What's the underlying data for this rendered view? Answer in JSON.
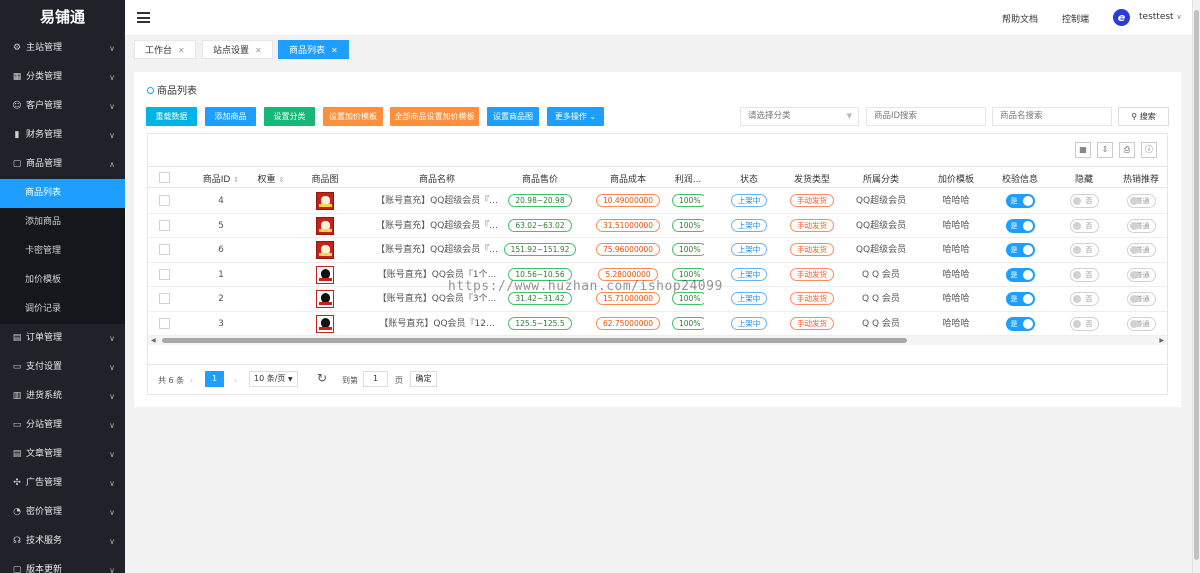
{
  "sidebar": {
    "logo": "易铺通",
    "menu_top": [
      {
        "label": "主站管理",
        "icon": "⚙",
        "icon_name": "gear-icon"
      },
      {
        "label": "分类管理",
        "icon": "▦",
        "icon_name": "grid-icon"
      },
      {
        "label": "客户管理",
        "icon": "☺",
        "icon_name": "user-icon"
      },
      {
        "label": "财务管理",
        "icon": "▮",
        "icon_name": "bar-chart-icon"
      },
      {
        "label": "商品管理",
        "icon": "▢",
        "icon_name": "box-icon"
      }
    ],
    "submenu": [
      {
        "label": "商品列表",
        "active": true
      },
      {
        "label": "添加商品",
        "active": false
      },
      {
        "label": "卡密管理",
        "active": false
      },
      {
        "label": "加价模板",
        "active": false
      },
      {
        "label": "调价记录",
        "active": false
      }
    ],
    "menu_bottom": [
      {
        "label": "订单管理",
        "icon": "▤",
        "icon_name": "order-icon"
      },
      {
        "label": "支付设置",
        "icon": "▭",
        "icon_name": "wallet-icon"
      },
      {
        "label": "进货系统",
        "icon": "▥",
        "icon_name": "stock-icon"
      },
      {
        "label": "分站管理",
        "icon": "▭",
        "icon_name": "monitor-icon"
      },
      {
        "label": "文章管理",
        "icon": "▤",
        "icon_name": "article-icon"
      },
      {
        "label": "广告管理",
        "icon": "✣",
        "icon_name": "ad-icon"
      },
      {
        "label": "密价管理",
        "icon": "◔",
        "icon_name": "price-icon"
      },
      {
        "label": "技术服务",
        "icon": "☊",
        "icon_name": "headset-icon"
      },
      {
        "label": "版本更新",
        "icon": "▢",
        "icon_name": "update-icon"
      }
    ]
  },
  "header": {
    "help": "帮助文档",
    "console": "控制端",
    "avatar_letter": "e",
    "username": "testtest"
  },
  "tabs": [
    {
      "label": "工作台",
      "active": false
    },
    {
      "label": "站点设置",
      "active": false
    },
    {
      "label": "商品列表",
      "active": true
    }
  ],
  "page": {
    "title": "商品列表",
    "buttons": [
      {
        "label": "重载数据",
        "color": "#00b5e5"
      },
      {
        "label": "添加商品",
        "color": "#1e9fff"
      },
      {
        "label": "设置分类",
        "color": "#16b777"
      },
      {
        "label": "设置加价模板",
        "color": "#ff8f3b"
      },
      {
        "label": "全部商品设置加价模板",
        "color": "#ff8f3b"
      },
      {
        "label": "设置商品图",
        "color": "#1e9fff"
      },
      {
        "label": "更多操作",
        "color": "#1e9fff"
      }
    ],
    "category_select": "请选择分类",
    "id_search_placeholder": "商品ID搜索",
    "name_search_placeholder": "商品名搜索",
    "search_label": "搜索"
  },
  "table": {
    "columns": [
      "商品ID",
      "权重",
      "商品图",
      "商品名称",
      "商品售价",
      "商品成本",
      "利润...",
      "状态",
      "发货类型",
      "所属分类",
      "加价模板",
      "校验信息",
      "隐藏",
      "热销推荐"
    ],
    "rows": [
      {
        "id": "4",
        "img": "vip",
        "name": "【账号直充】QQ超级会员『...",
        "price": "20.98~20.98",
        "cost": "10.49000000",
        "profit": "100%",
        "status": "上架中",
        "ship": "手动发货",
        "category": "QQ超级会员",
        "template": "哈哈哈",
        "verify": "是",
        "hidden": "否",
        "hot": "普通"
      },
      {
        "id": "5",
        "img": "vip",
        "name": "【账号直充】QQ超级会员『...",
        "price": "63.02~63.02",
        "cost": "31.51000000",
        "profit": "100%",
        "status": "上架中",
        "ship": "手动发货",
        "category": "QQ超级会员",
        "template": "哈哈哈",
        "verify": "是",
        "hidden": "否",
        "hot": "普通"
      },
      {
        "id": "6",
        "img": "vip",
        "name": "【账号直充】QQ超级会员『...",
        "price": "151.92~151.92",
        "cost": "75.96000000",
        "profit": "100%",
        "status": "上架中",
        "ship": "手动发货",
        "category": "QQ超级会员",
        "template": "哈哈哈",
        "verify": "是",
        "hidden": "否",
        "hot": "普通"
      },
      {
        "id": "1",
        "img": "qq",
        "name": "【账号直充】QQ会员『1个...",
        "price": "10.56~10.56",
        "cost": "5.28000000",
        "profit": "100%",
        "status": "上架中",
        "ship": "手动发货",
        "category": "Q Q 会员",
        "template": "哈哈哈",
        "verify": "是",
        "hidden": "否",
        "hot": "普通"
      },
      {
        "id": "2",
        "img": "qq",
        "name": "【账号直充】QQ会员『3个...",
        "price": "31.42~31.42",
        "cost": "15.71000000",
        "profit": "100%",
        "status": "上架中",
        "ship": "手动发货",
        "category": "Q Q 会员",
        "template": "哈哈哈",
        "verify": "是",
        "hidden": "否",
        "hot": "普通"
      },
      {
        "id": "3",
        "img": "qq",
        "name": "【账号直充】QQ会员『12...",
        "price": "125.5~125.5",
        "cost": "62.75000000",
        "profit": "100%",
        "status": "上架中",
        "ship": "手动发货",
        "category": "Q Q 会员",
        "template": "哈哈哈",
        "verify": "是",
        "hidden": "否",
        "hot": "普通"
      }
    ]
  },
  "pagination": {
    "total": "共 6 条",
    "current_page": "1",
    "page_size": "10 条/页",
    "goto_prefix": "到第",
    "goto_value": "1",
    "goto_suffix": "页",
    "confirm": "确定"
  },
  "watermark": "https://www.huzhan.com/ishop24099"
}
